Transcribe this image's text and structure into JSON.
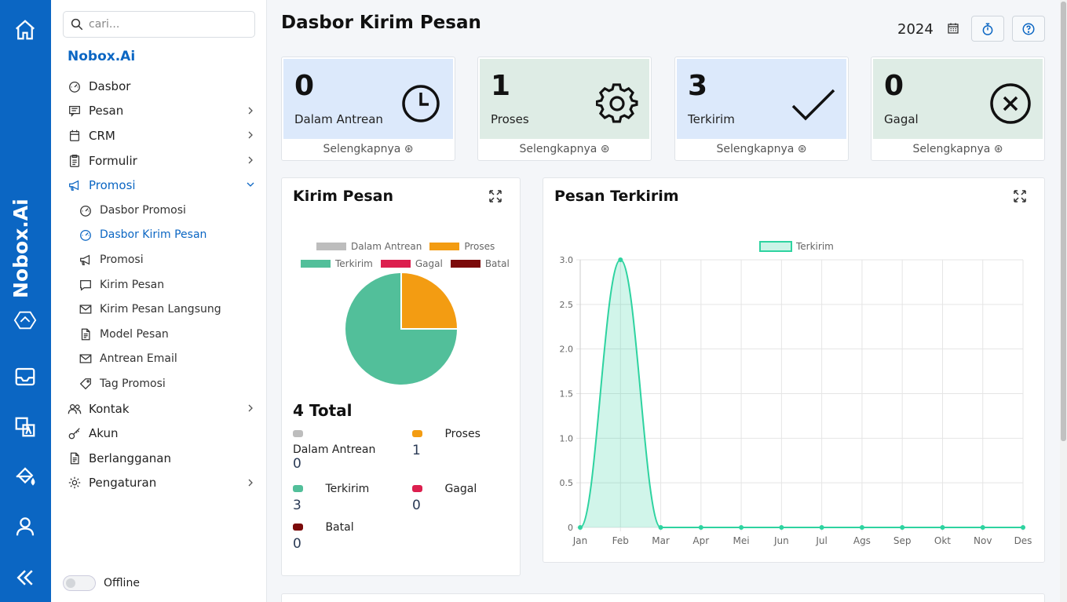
{
  "rail": {
    "brand": "Nobox.Ai",
    "icons": [
      "home-icon",
      "nobox-logo-icon",
      "inbox-icon",
      "translate-icon",
      "paint-bucket-icon",
      "user-icon",
      "collapse-icon"
    ]
  },
  "sidebar": {
    "search_placeholder": "cari...",
    "brand": "Nobox.Ai",
    "menu": [
      {
        "label": "Dasbor",
        "icon": "gauge-icon"
      },
      {
        "label": "Pesan",
        "icon": "message-icon",
        "chevron": true
      },
      {
        "label": "CRM",
        "icon": "calendar-icon",
        "chevron": true
      },
      {
        "label": "Formulir",
        "icon": "clipboard-icon",
        "chevron": true
      },
      {
        "label": "Promosi",
        "icon": "megaphone-icon",
        "chevron": "down",
        "active": true
      },
      {
        "label": "Dasbor Promosi",
        "icon": "gauge-icon",
        "sub": true
      },
      {
        "label": "Dasbor Kirim Pesan",
        "icon": "gauge-icon",
        "sub": true,
        "active": true
      },
      {
        "label": "Promosi",
        "icon": "megaphone-icon",
        "sub": true
      },
      {
        "label": "Kirim Pesan",
        "icon": "chat-icon",
        "sub": true
      },
      {
        "label": "Kirim Pesan Langsung",
        "icon": "mail-icon",
        "sub": true
      },
      {
        "label": "Model Pesan",
        "icon": "document-icon",
        "sub": true
      },
      {
        "label": "Antrean Email",
        "icon": "mail-icon",
        "sub": true
      },
      {
        "label": "Tag Promosi",
        "icon": "tag-icon",
        "sub": true
      },
      {
        "label": "Kontak",
        "icon": "users-icon",
        "chevron": true
      },
      {
        "label": "Akun",
        "icon": "key-icon"
      },
      {
        "label": "Berlangganan",
        "icon": "document-icon"
      },
      {
        "label": "Pengaturan",
        "icon": "gear-icon",
        "chevron": true
      }
    ],
    "offline_label": "Offline"
  },
  "header": {
    "title": "Dasbor Kirim Pesan",
    "year": "2024"
  },
  "stats": [
    {
      "value": "0",
      "label": "Dalam Antrean",
      "more": "Selengkapnya",
      "icon": "clock-icon",
      "color": "#dce9fb"
    },
    {
      "value": "1",
      "label": "Proses",
      "more": "Selengkapnya",
      "icon": "gear-icon",
      "color": "#deece5"
    },
    {
      "value": "3",
      "label": "Terkirim",
      "more": "Selengkapnya",
      "icon": "check-icon",
      "color": "#dce9fb"
    },
    {
      "value": "0",
      "label": "Gagal",
      "more": "Selengkapnya",
      "icon": "x-circle-icon",
      "color": "#deece5"
    }
  ],
  "kirim_pesan": {
    "title": "Kirim Pesan",
    "total": "4 Total",
    "items": [
      {
        "label": "Dalam Antrean",
        "value": "0",
        "color": "#bdbdbd"
      },
      {
        "label": "Proses",
        "value": "1",
        "color": "#f39c12"
      },
      {
        "label": "Terkirim",
        "value": "3",
        "color": "#52bf9a"
      },
      {
        "label": "Gagal",
        "value": "0",
        "color": "#dc1f4e"
      },
      {
        "label": "Batal",
        "value": "0",
        "color": "#7b0a0a"
      }
    ]
  },
  "pesan_terkirim": {
    "title": "Pesan Terkirim"
  },
  "chart_data": [
    {
      "type": "pie",
      "categories": [
        "Dalam Antrean",
        "Proses",
        "Terkirim",
        "Gagal",
        "Batal"
      ],
      "values": [
        0,
        1,
        3,
        0,
        0
      ],
      "colors": [
        "#bdbdbd",
        "#f39c12",
        "#52bf9a",
        "#dc1f4e",
        "#7b0a0a"
      ],
      "legend": "top"
    },
    {
      "type": "area",
      "categories": [
        "Jan",
        "Feb",
        "Mar",
        "Apr",
        "Mei",
        "Jun",
        "Jul",
        "Ags",
        "Sep",
        "Okt",
        "Nov",
        "Des"
      ],
      "series": [
        {
          "name": "Terkirim",
          "values": [
            0,
            3,
            0,
            0,
            0,
            0,
            0,
            0,
            0,
            0,
            0,
            0
          ]
        }
      ],
      "yticks": [
        "0",
        "0.5",
        "1.0",
        "1.5",
        "2.0",
        "2.5",
        "3.0"
      ],
      "ylim": [
        0,
        3
      ],
      "grid": true,
      "legend": "top",
      "color": "#2ed3a0"
    }
  ]
}
